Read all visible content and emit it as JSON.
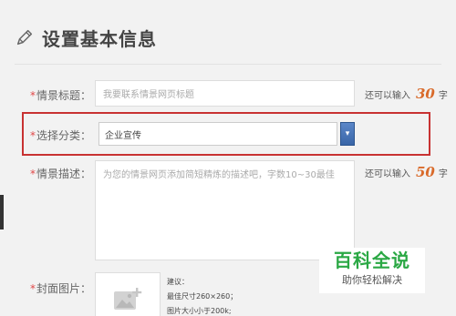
{
  "header": {
    "title": "设置基本信息",
    "icon": "pencil-icon"
  },
  "fields": {
    "title": {
      "required_mark": "*",
      "label": "情景标题：",
      "placeholder": "我要联系情景网页标题",
      "hint_prefix": "还可以输入",
      "hint_count": "30",
      "hint_suffix": "字"
    },
    "category": {
      "required_mark": "*",
      "label": "选择分类：",
      "selected": "企业宣传",
      "arrow": "▾"
    },
    "description": {
      "required_mark": "*",
      "label": "情景描述：",
      "placeholder": "为您的情景网页添加简短精炼的描述吧，字数10~30最佳",
      "hint_prefix": "还可以输入",
      "hint_count": "50",
      "hint_suffix": "字"
    },
    "cover": {
      "required_mark": "*",
      "label": "封面图片：",
      "icon": "add-image-icon",
      "note_lines": [
        "建议：",
        "最佳尺寸260×260；",
        "图片大小小于200k;"
      ]
    }
  },
  "watermark": {
    "title": "百科全说",
    "subtitle": "助你轻松解决",
    "color": "#2aa844"
  },
  "colors": {
    "highlight": "#c83232",
    "required": "#e04848",
    "count": "#d96a2a",
    "select_arrow": "#3a66a8"
  }
}
